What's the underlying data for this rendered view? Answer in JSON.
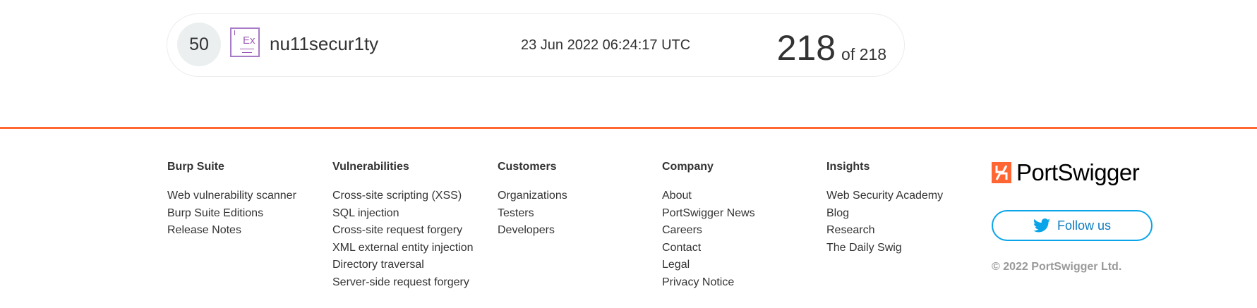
{
  "entry": {
    "rank": "50",
    "badge_label": "Ex",
    "username": "nu11secur1ty",
    "timestamp": "23 Jun 2022 06:24:17 UTC",
    "solved_count": "218",
    "solved_total": "of 218"
  },
  "footer": {
    "columns": [
      {
        "heading": "Burp Suite",
        "links": [
          "Web vulnerability scanner",
          "Burp Suite Editions",
          "Release Notes"
        ]
      },
      {
        "heading": "Vulnerabilities",
        "links": [
          "Cross-site scripting (XSS)",
          "SQL injection",
          "Cross-site request forgery",
          "XML external entity injection",
          "Directory traversal",
          "Server-side request forgery"
        ]
      },
      {
        "heading": "Customers",
        "links": [
          "Organizations",
          "Testers",
          "Developers"
        ]
      },
      {
        "heading": "Company",
        "links": [
          "About",
          "PortSwigger News",
          "Careers",
          "Contact",
          "Legal",
          "Privacy Notice"
        ]
      },
      {
        "heading": "Insights",
        "links": [
          "Web Security Academy",
          "Blog",
          "Research",
          "The Daily Swig"
        ]
      }
    ],
    "brand_name": "PortSwigger",
    "follow_label": "Follow us",
    "copyright": "© 2022 PortSwigger Ltd."
  },
  "colors": {
    "accent": "#ff6633",
    "twitter": "#0aa5e9",
    "badge": "#9b59b6"
  },
  "icons": {
    "badge": "expert-badge-icon",
    "logo": "portswigger-logo-icon",
    "follow": "twitter-bird-icon"
  }
}
